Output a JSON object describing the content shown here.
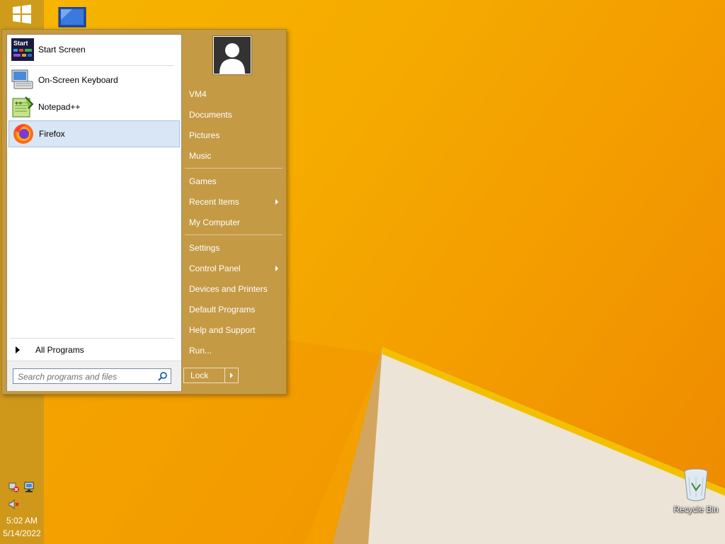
{
  "desktop": {
    "recycle_bin_label": "Recycle Bin"
  },
  "taskbar": {
    "start_icon": "windows-logo-icon",
    "pinned_icon": "computer-icon",
    "tray_icons": [
      "network-error-icon",
      "network-icon",
      "speaker-muted-icon"
    ],
    "clock": {
      "time": "5:02 AM",
      "date": "5/14/2022"
    }
  },
  "start_menu": {
    "programs": [
      {
        "label": "Start Screen",
        "icon": "start-screen-icon"
      },
      {
        "label": "On-Screen Keyboard",
        "icon": "keyboard-icon"
      },
      {
        "label": "Notepad++",
        "icon": "notepad-plus-plus-icon"
      },
      {
        "label": "Firefox",
        "icon": "firefox-icon",
        "selected": true
      }
    ],
    "start_icon_text": "Start",
    "all_programs_label": "All Programs",
    "search_placeholder": "Search programs and files",
    "user_avatar": "user-avatar-icon",
    "right_items": [
      {
        "label": "VM4"
      },
      {
        "label": "Documents"
      },
      {
        "label": "Pictures"
      },
      {
        "label": "Music"
      },
      {
        "label": "Games"
      },
      {
        "label": "Recent Items",
        "submenu": true
      },
      {
        "label": "My Computer"
      },
      {
        "label": "Settings"
      },
      {
        "label": "Control Panel",
        "submenu": true
      },
      {
        "label": "Devices and Printers"
      },
      {
        "label": "Default Programs"
      },
      {
        "label": "Help and Support"
      },
      {
        "label": "Run..."
      }
    ],
    "lock_label": "Lock"
  },
  "colors": {
    "wallpaper": "#f5aa00",
    "menu_bg": "#c49a45",
    "selected_bg": "#d9e6f5"
  }
}
